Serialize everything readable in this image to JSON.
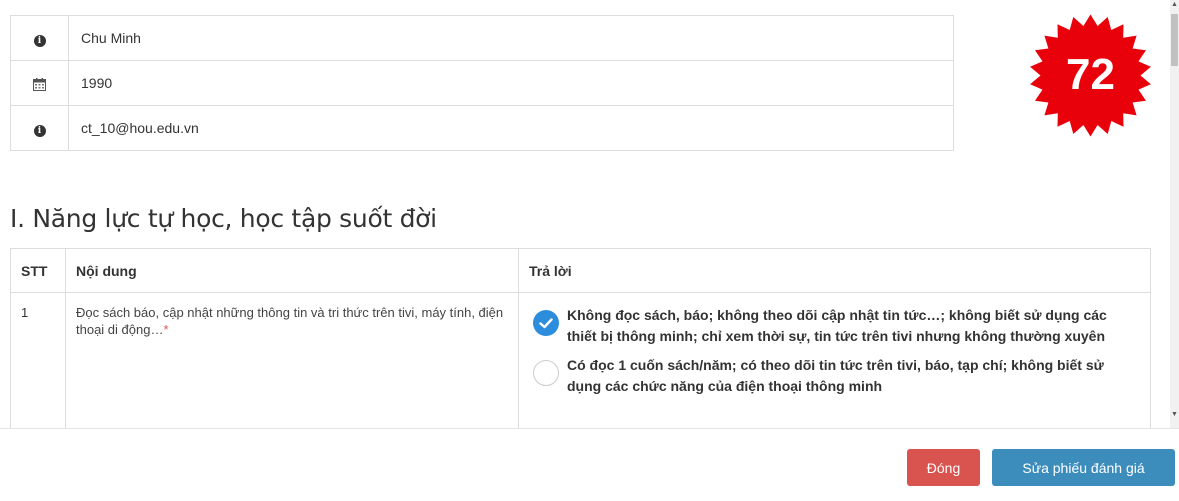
{
  "profile": {
    "name": "Chu Minh",
    "birth_year": "1990",
    "email": "ct_10@hou.edu.vn",
    "icons": [
      "info-icon",
      "calendar-icon",
      "info-icon"
    ]
  },
  "score_badge": {
    "value": "72",
    "color": "#e8000b"
  },
  "section": {
    "title": "I. Năng lực tự học, học tập suốt đời"
  },
  "table": {
    "headers": {
      "stt": "STT",
      "content": "Nội dung",
      "answer": "Trả lời"
    },
    "rows": [
      {
        "stt": "1",
        "question": "Đọc sách báo, cập nhật những thông tin và tri thức trên tivi, máy tính, điện thoại di động…",
        "required_mark": "*",
        "options": [
          {
            "text": "Không đọc sách, báo; không theo dõi cập nhật tin tức…; không biết sử dụng các thiết bị thông minh; chỉ xem thời sự, tin tức trên tivi nhưng không thường xuyên",
            "checked": true
          },
          {
            "text": "Có đọc 1 cuốn sách/năm; có theo dõi tin tức trên tivi, báo, tạp chí; không biết sử dụng các chức năng của điện thoại thông minh",
            "checked": false
          }
        ]
      }
    ]
  },
  "footer": {
    "close_label": "Đóng",
    "edit_label": "Sửa phiếu đánh giá",
    "close_color": "#d9534f",
    "edit_color": "#3c8dbc"
  }
}
